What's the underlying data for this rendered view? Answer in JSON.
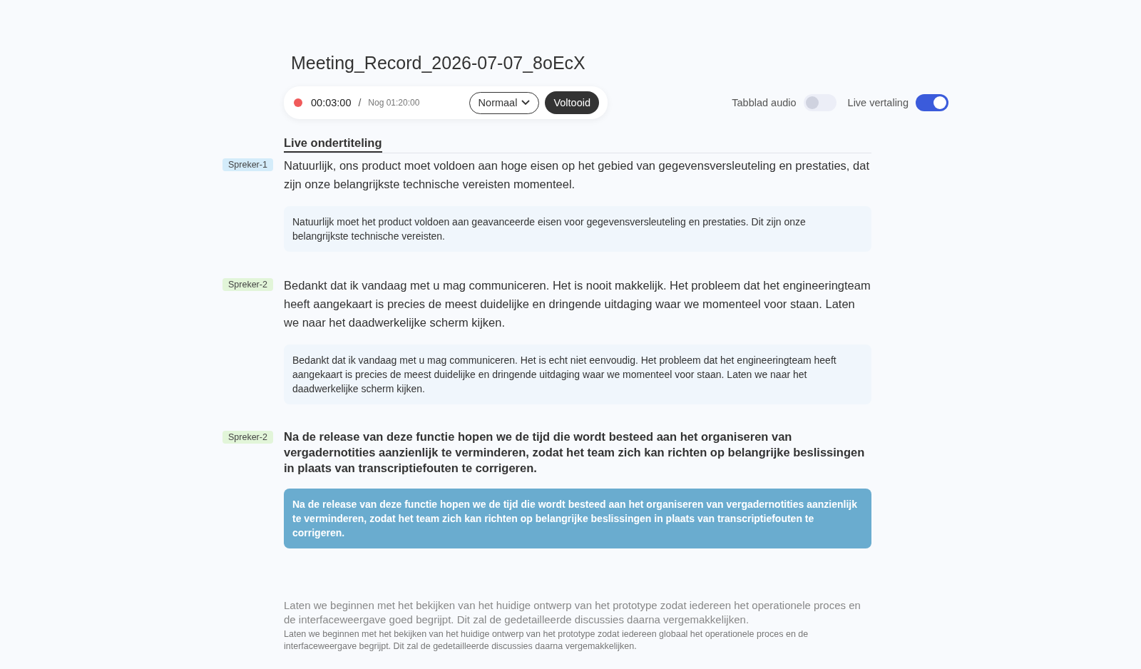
{
  "title": "Meeting_Record_2026-07-07_8oEcX",
  "recording": {
    "active": true,
    "elapsed": "00:03:00",
    "separator": "/",
    "remaining": "Nog 01:20:00"
  },
  "mode_select": {
    "value": "Normaal"
  },
  "finish_button": "Voltooid",
  "toggles": [
    {
      "label": "Tabblad audio",
      "on": false
    },
    {
      "label": "Live vertaling",
      "on": true
    }
  ],
  "section_title": "Live ondertiteling",
  "segments": [
    {
      "kind": "final",
      "speaker": "Spreker-1",
      "color": "#d4ecfa",
      "text": "Natuurlijk, ons product moet voldoen aan hoge eisen op het gebied van gegevensversleuteling en prestaties, dat zijn onze belangrijkste technische vereisten momenteel.",
      "translation": "Natuurlijk moet het product voldoen aan geavanceerde eisen voor gegevensversleuteling en prestaties. Dit zijn onze belangrijkste technische vereisten."
    },
    {
      "kind": "final",
      "speaker": "Spreker-2",
      "color": "#e2f5d9",
      "text": "Bedankt dat ik vandaag met u mag communiceren. Het is nooit makkelijk. Het probleem dat het engineeringteam heeft aangekaart is precies de meest duidelijke en dringende uitdaging waar we momenteel voor staan. Laten we naar het daadwerkelijke scherm kijken.",
      "translation": "Bedankt dat ik vandaag met u mag communiceren. Het is echt niet eenvoudig. Het probleem dat het engineeringteam heeft aangekaart is precies de meest duidelijke en dringende uitdaging waar we momenteel voor staan. Laten we naar het daadwerkelijke scherm kijken."
    },
    {
      "kind": "active",
      "speaker": "Spreker-2",
      "color": "#e2f5d9",
      "text": "Na de release van deze functie hopen we de tijd die wordt besteed aan het organiseren van vergadernotities aanzienlijk te verminderen, zodat het team zich kan richten op belangrijke beslissingen in plaats van transcriptiefouten te corrigeren.",
      "translation": "Na de release van deze functie hopen we de tijd die wordt besteed aan het organiseren van vergadernotities aanzienlijk te verminderen, zodat het team zich kan richten op belangrijke beslissingen in plaats van transcriptiefouten te corrigeren."
    },
    {
      "kind": "pending",
      "text": "Laten we beginnen met het bekijken van het huidige ontwerp van het prototype zodat iedereen het operationele proces en de interfaceweergave goed begrijpt. Dit zal de gedetailleerde discussies daarna vergemakkelijken.",
      "translation": "Laten we beginnen met het bekijken van het huidige ontwerp van het prototype zodat iedereen globaal het operationele proces en de interfaceweergave begrijpt. Dit zal de gedetailleerde discussies daarna vergemakkelijken."
    }
  ]
}
